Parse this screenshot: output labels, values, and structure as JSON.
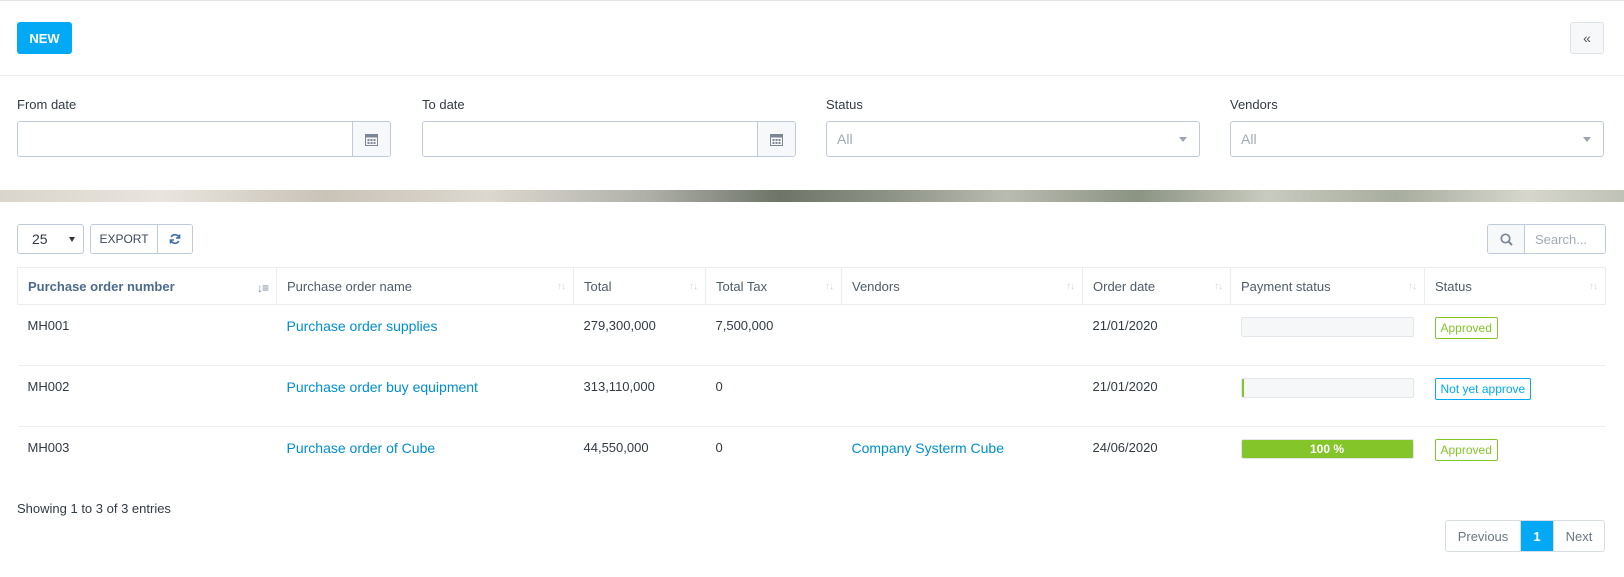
{
  "toolbar": {
    "new_label": "NEW",
    "collapse_label": "«"
  },
  "filters": {
    "from_date": {
      "label": "From date",
      "value": ""
    },
    "to_date": {
      "label": "To date",
      "value": ""
    },
    "status": {
      "label": "Status",
      "selected": "All"
    },
    "vendors": {
      "label": "Vendors",
      "selected": "All"
    }
  },
  "table_controls": {
    "page_length": "25",
    "export_label": "EXPORT",
    "search_placeholder": "Search..."
  },
  "table": {
    "columns": [
      "Purchase order number",
      "Purchase order name",
      "Total",
      "Total Tax",
      "Vendors",
      "Order date",
      "Payment status",
      "Status"
    ],
    "sorted_column": "Purchase order number",
    "rows": [
      {
        "number": "MH001",
        "name": "Purchase order supplies",
        "total": "279,300,000",
        "tax": "7,500,000",
        "vendor": "",
        "date": "21/01/2020",
        "payment_percent": 0,
        "payment_label": "",
        "status": "Approved"
      },
      {
        "number": "MH002",
        "name": "Purchase order buy equipment",
        "total": "313,110,000",
        "tax": "0",
        "vendor": "",
        "date": "21/01/2020",
        "payment_percent": 1,
        "payment_label": "",
        "status": "Not yet approve"
      },
      {
        "number": "MH003",
        "name": "Purchase order of Cube",
        "total": "44,550,000",
        "tax": "0",
        "vendor": "Company Systerm Cube",
        "date": "24/06/2020",
        "payment_percent": 100,
        "payment_label": "100 %",
        "status": "Approved"
      }
    ]
  },
  "footer": {
    "info": "Showing 1 to 3 of 3 entries",
    "pagination": {
      "previous": "Previous",
      "current": "1",
      "next": "Next"
    }
  },
  "colors": {
    "accent": "#03a9f4",
    "success": "#84c529",
    "link": "#008ece"
  }
}
